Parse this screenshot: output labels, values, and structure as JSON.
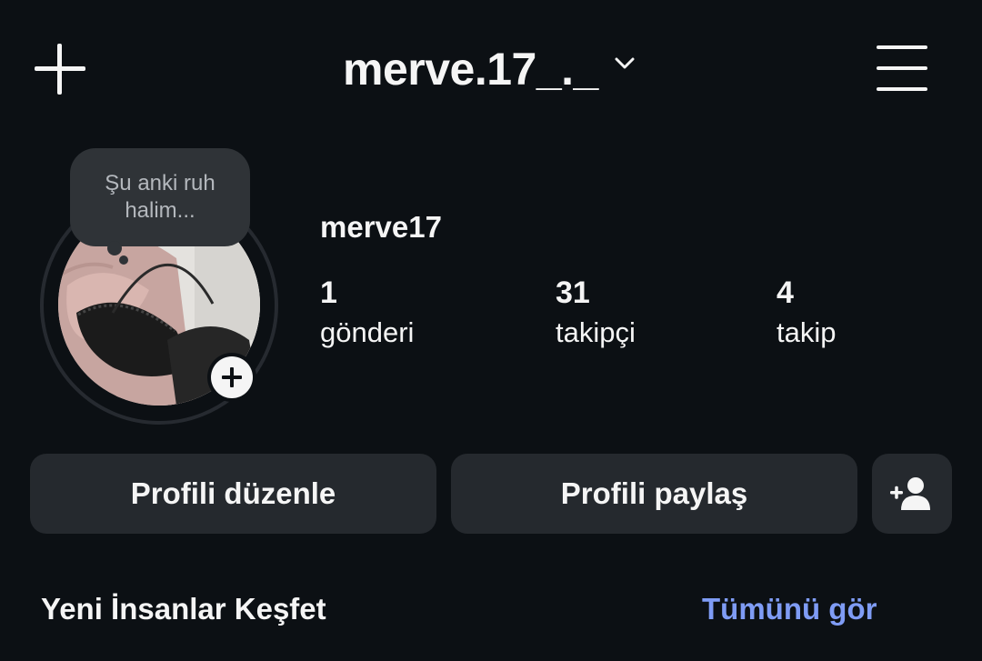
{
  "header": {
    "username": "merve.17_._"
  },
  "profile": {
    "display_name": "merve17",
    "note": "Şu anki ruh halim...",
    "stats": [
      {
        "value": "1",
        "label": "gönderi"
      },
      {
        "value": "31",
        "label": "takipçi"
      },
      {
        "value": "4",
        "label": "takip"
      }
    ]
  },
  "actions": {
    "edit_profile": "Profili düzenle",
    "share_profile": "Profili paylaş"
  },
  "discover": {
    "title": "Yeni İnsanlar Keşfet",
    "see_all": "Tümünü gör"
  },
  "colors": {
    "background": "#0c1014",
    "button": "#25292e",
    "link": "#7f9cf5",
    "note_bubble": "#2f3337"
  }
}
